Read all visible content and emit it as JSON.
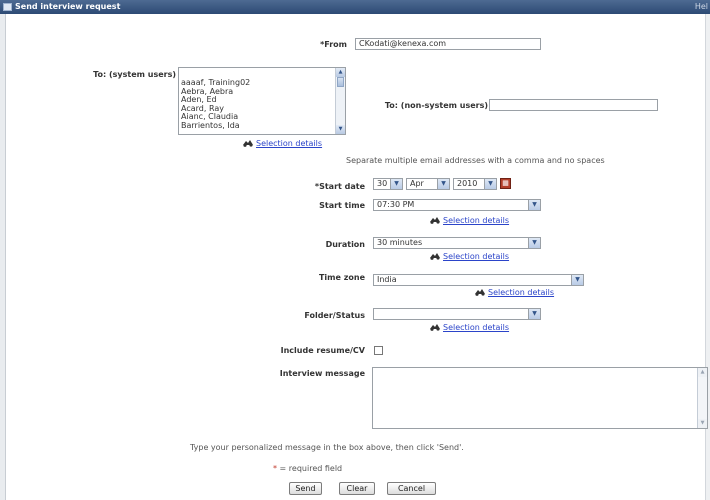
{
  "window": {
    "title": "Send interview request",
    "corner_text": "Hel"
  },
  "form": {
    "from": {
      "label": "From",
      "required_mark": "*",
      "value": "CKodati@kenexa.com"
    },
    "to_system": {
      "label": "To: (system users)",
      "items": [
        "aaaaf, Training02",
        "Aebra, Aebra",
        "Aden, Ed",
        "Acard, Ray",
        "Aianc, Claudia",
        "Barrientos, Ida"
      ]
    },
    "to_system_link": "Selection details",
    "to_non_system": {
      "label": "To: (non-system users)",
      "value": ""
    },
    "hint_emails": "Separate multiple email addresses with a comma and no spaces",
    "start_date": {
      "label": "Start date",
      "required_mark": "*",
      "day": "30",
      "month": "Apr",
      "year": "2010",
      "cal_icon": "calendar-icon"
    },
    "start_time": {
      "label": "Start time",
      "value": "07:30 PM",
      "link": "Selection details"
    },
    "duration": {
      "label": "Duration",
      "value": "30 minutes",
      "link": "Selection details"
    },
    "time_zone": {
      "label": "Time zone",
      "value": "India",
      "link": "Selection details"
    },
    "folder_status": {
      "label": "Folder/Status",
      "value": "",
      "link": "Selection details"
    },
    "include_resume": {
      "label": "Include resume/CV",
      "checked": false
    },
    "interview_message": {
      "label": "Interview message",
      "value": ""
    },
    "footer_hint": "Type your personalized message in the box above, then click 'Send'.",
    "required_note": {
      "mark": "*",
      "text": "= required field"
    },
    "buttons": {
      "send": "Send",
      "clear": "Clear",
      "cancel": "Cancel"
    }
  },
  "colors": {
    "title_bar": "#3b5a85",
    "link": "#2b44c9",
    "required": "#c0392b"
  }
}
